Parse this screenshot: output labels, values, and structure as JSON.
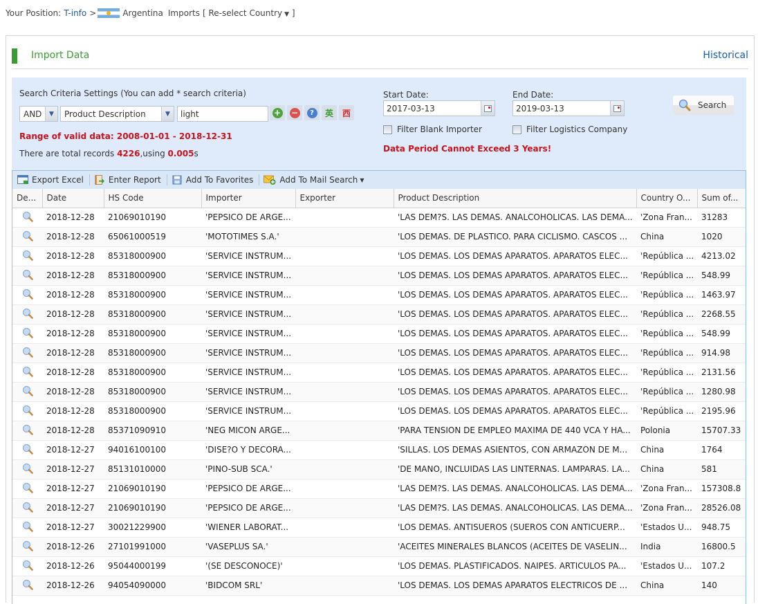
{
  "breadcrumb": {
    "prefix": "Your Position:",
    "site": "T-info",
    "sep": ">",
    "country": "Argentina",
    "section": "Imports",
    "reselect": "[ Re-select Country",
    "reselect_close": "]"
  },
  "panel": {
    "title": "Import Data",
    "historical_link": "Historical"
  },
  "criteria": {
    "heading": "Search Criteria Settings (You can add * search criteria)",
    "logic_select": "AND",
    "field_select": "Product Description",
    "keyword": "light",
    "zh_en_label": "英",
    "zh_es_label": "西",
    "range_text": "Range of valid data: 2008-01-01 - 2018-12-31",
    "total_prefix": "There are total records ",
    "total_count": "4226",
    "total_mid": ",using ",
    "total_time": "0.005",
    "total_suffix": "s",
    "start_label": "Start Date:",
    "start_value": "2017-03-13",
    "end_label": "End Date:",
    "end_value": "2019-03-13",
    "filter_blank_importer": "Filter Blank Importer",
    "filter_logistics": "Filter Logistics Company",
    "warning": "Data Period Cannot Exceed 3 Years!",
    "search_button": "Search"
  },
  "toolbar": {
    "export_excel": "Export Excel",
    "enter_report": "Enter Report",
    "add_favorites": "Add To Favorites",
    "add_mail_search": "Add To Mail Search"
  },
  "table": {
    "columns": [
      "De...",
      "Date",
      "HS Code",
      "Importer",
      "Exporter",
      "Product Description",
      "Country O...",
      "Sum of..."
    ],
    "rows": [
      {
        "date": "2018-12-28",
        "hs": "21069010190",
        "importer": "'PEPSICO DE ARGE...",
        "exporter": "",
        "desc": "'LAS DEM?S. LAS DEMAS. ANALCOHOLICAS. LAS DEMA...",
        "country": "'Zona Fran...",
        "sum": "31283"
      },
      {
        "date": "2018-12-28",
        "hs": "65061000519",
        "importer": "'MOTOTIMES S.A.'",
        "exporter": "",
        "desc": "'LOS DEMAS. DE PLASTICO. PARA CICLISMO. CASCOS ...",
        "country": "China",
        "sum": "1020"
      },
      {
        "date": "2018-12-28",
        "hs": "85318000900",
        "importer": "'SERVICE INSTRUM...",
        "exporter": "",
        "desc": "'LOS DEMAS. LOS DEMAS APARATOS. APARATOS ELEC...",
        "country": "'República ...",
        "sum": "4213.02"
      },
      {
        "date": "2018-12-28",
        "hs": "85318000900",
        "importer": "'SERVICE INSTRUM...",
        "exporter": "",
        "desc": "'LOS DEMAS. LOS DEMAS APARATOS. APARATOS ELEC...",
        "country": "'República ...",
        "sum": "548.99"
      },
      {
        "date": "2018-12-28",
        "hs": "85318000900",
        "importer": "'SERVICE INSTRUM...",
        "exporter": "",
        "desc": "'LOS DEMAS. LOS DEMAS APARATOS. APARATOS ELEC...",
        "country": "'República ...",
        "sum": "1463.97"
      },
      {
        "date": "2018-12-28",
        "hs": "85318000900",
        "importer": "'SERVICE INSTRUM...",
        "exporter": "",
        "desc": "'LOS DEMAS. LOS DEMAS APARATOS. APARATOS ELEC...",
        "country": "'República ...",
        "sum": "2268.55"
      },
      {
        "date": "2018-12-28",
        "hs": "85318000900",
        "importer": "'SERVICE INSTRUM...",
        "exporter": "",
        "desc": "'LOS DEMAS. LOS DEMAS APARATOS. APARATOS ELEC...",
        "country": "'República ...",
        "sum": "548.99"
      },
      {
        "date": "2018-12-28",
        "hs": "85318000900",
        "importer": "'SERVICE INSTRUM...",
        "exporter": "",
        "desc": "'LOS DEMAS. LOS DEMAS APARATOS. APARATOS ELEC...",
        "country": "'República ...",
        "sum": "914.98"
      },
      {
        "date": "2018-12-28",
        "hs": "85318000900",
        "importer": "'SERVICE INSTRUM...",
        "exporter": "",
        "desc": "'LOS DEMAS. LOS DEMAS APARATOS. APARATOS ELEC...",
        "country": "'República ...",
        "sum": "2131.56"
      },
      {
        "date": "2018-12-28",
        "hs": "85318000900",
        "importer": "'SERVICE INSTRUM...",
        "exporter": "",
        "desc": "'LOS DEMAS. LOS DEMAS APARATOS. APARATOS ELEC...",
        "country": "'República ...",
        "sum": "1280.98"
      },
      {
        "date": "2018-12-28",
        "hs": "85318000900",
        "importer": "'SERVICE INSTRUM...",
        "exporter": "",
        "desc": "'LOS DEMAS. LOS DEMAS APARATOS. APARATOS ELEC...",
        "country": "'República ...",
        "sum": "2195.96"
      },
      {
        "date": "2018-12-28",
        "hs": "85371090910",
        "importer": "'NEG MICON ARGE...",
        "exporter": "",
        "desc": "'PARA TENSION DE EMPLEO MAXIMA DE 440 VCA Y HA...",
        "country": "Polonia",
        "sum": "15707.33"
      },
      {
        "date": "2018-12-27",
        "hs": "94016100100",
        "importer": "'DISE?O Y DECORA...",
        "exporter": "",
        "desc": "'SILLAS. LOS DEMAS ASIENTOS, CON ARMAZON DE M...",
        "country": "China",
        "sum": "1764"
      },
      {
        "date": "2018-12-27",
        "hs": "85131010000",
        "importer": "'PINO-SUB SCA.'",
        "exporter": "",
        "desc": "'DE MANO, INCLUIDAS LAS LINTERNAS. LAMPARAS. LA...",
        "country": "China",
        "sum": "581"
      },
      {
        "date": "2018-12-27",
        "hs": "21069010190",
        "importer": "'PEPSICO DE ARGE...",
        "exporter": "",
        "desc": "'LAS DEM?S. LAS DEMAS. ANALCOHOLICAS. LAS DEMA...",
        "country": "'Zona Fran...",
        "sum": "157308.8"
      },
      {
        "date": "2018-12-27",
        "hs": "21069010190",
        "importer": "'PEPSICO DE ARGE...",
        "exporter": "",
        "desc": "'LAS DEM?S. LAS DEMAS. ANALCOHOLICAS. LAS DEMA...",
        "country": "'Zona Fran...",
        "sum": "28526.08"
      },
      {
        "date": "2018-12-27",
        "hs": "30021229900",
        "importer": "'WIENER LABORAT...",
        "exporter": "",
        "desc": "'LOS DEMAS. ANTISUEROS (SUEROS CON ANTICUERP...",
        "country": "'Estados U...",
        "sum": "948.75"
      },
      {
        "date": "2018-12-26",
        "hs": "27101991000",
        "importer": "'VASEPLUS SA.'",
        "exporter": "",
        "desc": "'ACEITES MINERALES BLANCOS (ACEITES DE VASELIN...",
        "country": "India",
        "sum": "16800.5"
      },
      {
        "date": "2018-12-26",
        "hs": "95044000199",
        "importer": "'(SE DESCONOCE)'",
        "exporter": "",
        "desc": "'LOS DEMAS. PLASTIFICADOS. NAIPES. ARTICULOS PA...",
        "country": "'Estados U...",
        "sum": "107.2"
      },
      {
        "date": "2018-12-26",
        "hs": "94054090000",
        "importer": "'BIDCOM SRL'",
        "exporter": "",
        "desc": "'LOS DEMAS. LOS DEMAS APARATOS ELECTRICOS DE ...",
        "country": "China",
        "sum": "140"
      }
    ]
  },
  "colors": {
    "accent_green": "#3d9b35",
    "link_blue": "#1a5aa8",
    "alert_red": "#c8141e",
    "criteria_bg": "#dfeafa",
    "toolbar_bg": "#dae7f6"
  }
}
